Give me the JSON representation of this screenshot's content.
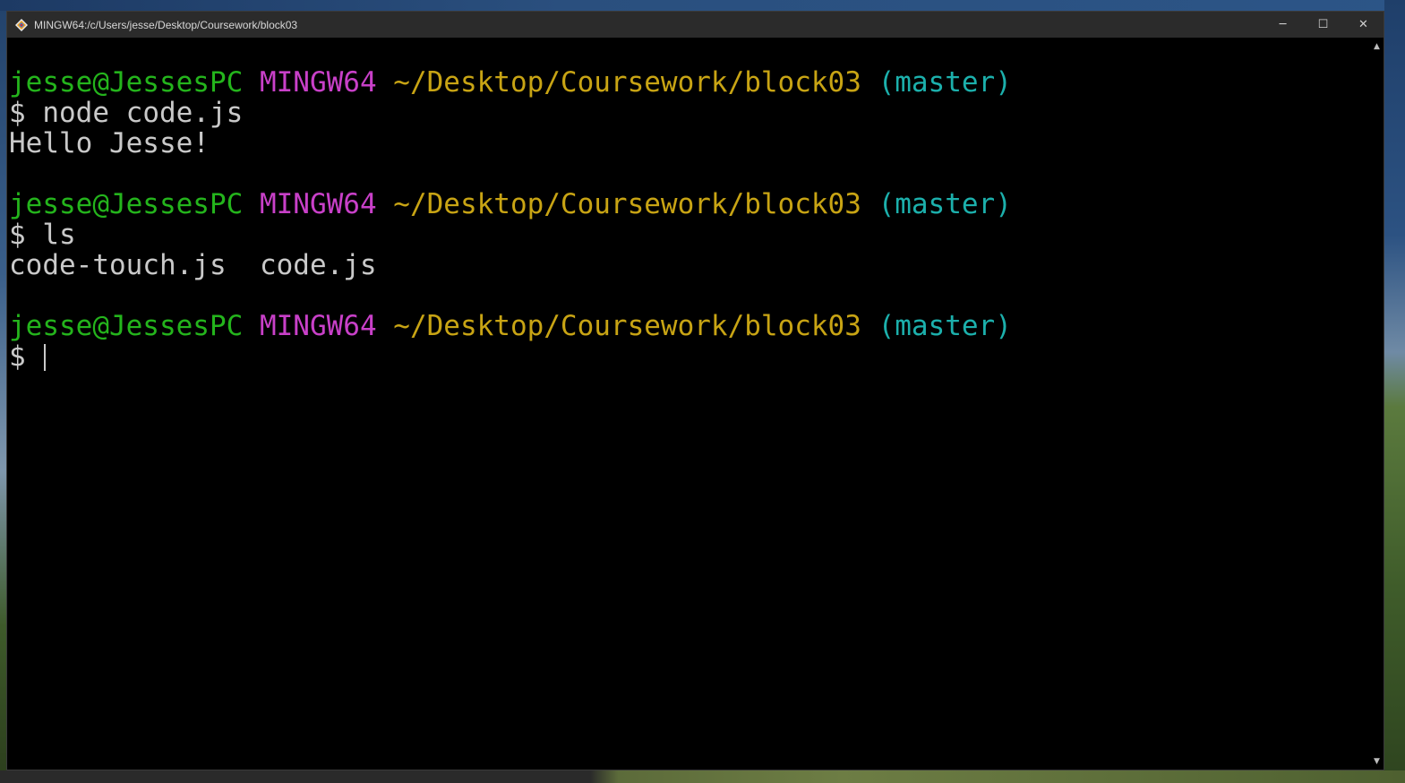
{
  "window": {
    "title": "MINGW64:/c/Users/jesse/Desktop/Coursework/block03",
    "controls": {
      "minimize": "─",
      "maximize": "☐",
      "close": "✕"
    }
  },
  "prompt": {
    "user_host": "jesse@JessesPC",
    "system": "MINGW64",
    "path": "~/Desktop/Coursework/block03",
    "branch": "(master)",
    "symbol": "$"
  },
  "session": {
    "cmd1": "node code.js",
    "out1": "Hello Jesse!",
    "cmd2": "ls",
    "out2": "code-touch.js  code.js"
  },
  "colors": {
    "user": "#24b41c",
    "system": "#c840c8",
    "path": "#c8a414",
    "branch": "#1cb0ac",
    "text": "#c9c9c9",
    "background": "#000000"
  },
  "icons": {
    "app": "git-bash-icon",
    "scroll_up": "scroll-up-arrow-icon",
    "scroll_down": "scroll-down-arrow-icon"
  }
}
